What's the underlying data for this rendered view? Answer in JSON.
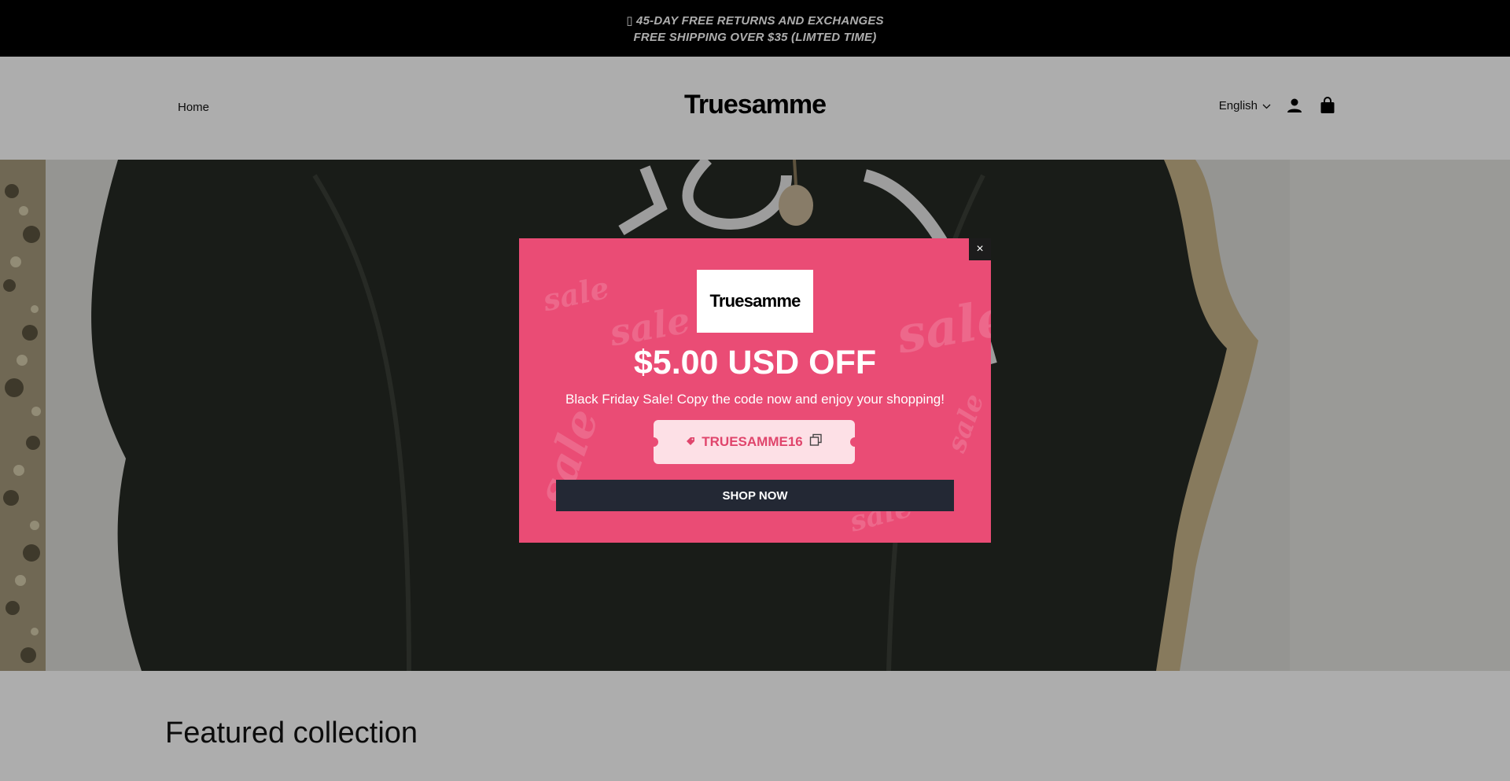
{
  "announcement": {
    "line1": "▯ 45-DAY FREE RETURNS AND EXCHANGES",
    "line2": "FREE SHIPPING OVER $35 (LIMTED TIME)"
  },
  "header": {
    "nav_home": "Home",
    "logo": "Truesamme",
    "language": "English",
    "icons": [
      "account-icon",
      "cart-icon"
    ]
  },
  "featured": {
    "title": "Featured collection"
  },
  "popup": {
    "logo": "Truesamme",
    "title": "$5.00 USD OFF",
    "subtitle": "Black Friday Sale! Copy the code now and enjoy your shopping!",
    "coupon_code": "TRUESAMME16",
    "shop_button": "SHOP NOW",
    "close_label": "×",
    "decoration_text": "sale",
    "colors": {
      "background": "#ea4c75",
      "coupon_bg": "#fde0e6",
      "coupon_text": "#e0456c",
      "button_bg": "#232834"
    }
  }
}
